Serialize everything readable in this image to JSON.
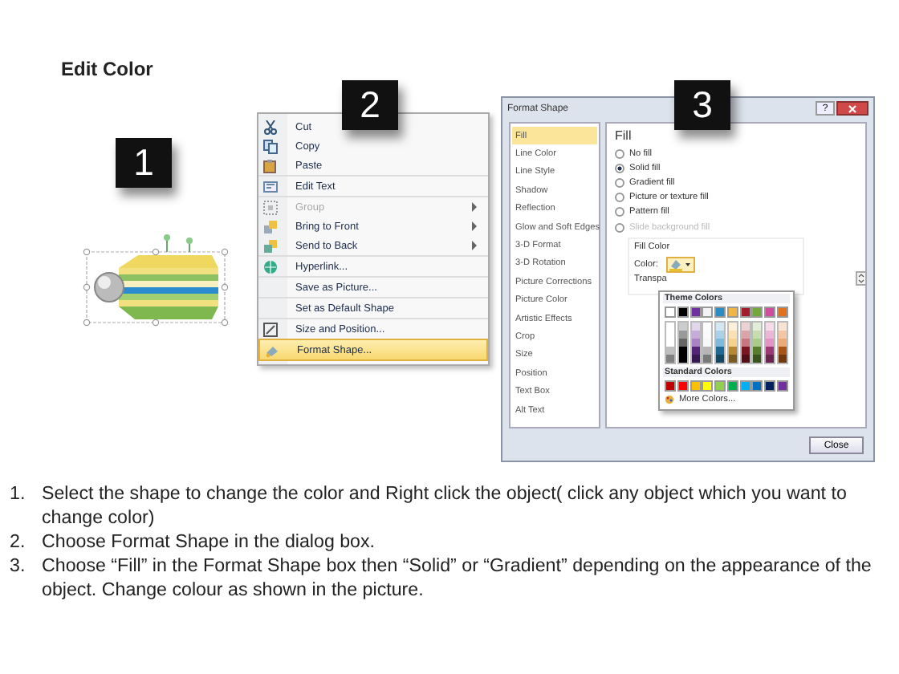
{
  "title": "Edit Color",
  "step_one": {
    "badge": "1"
  },
  "context_menu": {
    "badge": "2",
    "items": [
      {
        "label": "Cut",
        "submenu": false,
        "disabled": false,
        "selected": false,
        "separator_after": false
      },
      {
        "label": "Copy",
        "submenu": false,
        "disabled": false,
        "selected": false,
        "separator_after": false
      },
      {
        "label": "Paste",
        "submenu": false,
        "disabled": false,
        "selected": false,
        "separator_after": true
      },
      {
        "label": "Edit Text",
        "submenu": false,
        "disabled": false,
        "selected": false,
        "separator_after": true
      },
      {
        "label": "Group",
        "submenu": true,
        "disabled": true,
        "selected": false,
        "separator_after": false
      },
      {
        "label": "Bring to Front",
        "submenu": true,
        "disabled": false,
        "selected": false,
        "separator_after": false
      },
      {
        "label": "Send to Back",
        "submenu": true,
        "disabled": false,
        "selected": false,
        "separator_after": true
      },
      {
        "label": "Hyperlink...",
        "submenu": false,
        "disabled": false,
        "selected": false,
        "separator_after": true
      },
      {
        "label": "Save as Picture...",
        "submenu": false,
        "disabled": false,
        "selected": false,
        "separator_after": true
      },
      {
        "label": "Set as Default Shape",
        "submenu": false,
        "disabled": false,
        "selected": false,
        "separator_after": true
      },
      {
        "label": "Size and Position...",
        "submenu": false,
        "disabled": false,
        "selected": false,
        "separator_after": false
      },
      {
        "label": "Format Shape...",
        "submenu": false,
        "disabled": false,
        "selected": true,
        "separator_after": false
      }
    ]
  },
  "dialog": {
    "badge": "3",
    "title": "Format Shape",
    "help": "?",
    "categories": [
      {
        "label": "Fill",
        "selected": true
      },
      {
        "label": "Line Color",
        "selected": false
      },
      {
        "label": "Line Style",
        "selected": false
      },
      {
        "label": "Shadow",
        "selected": false
      },
      {
        "label": "Reflection",
        "selected": false
      },
      {
        "label": "Glow and Soft Edges",
        "selected": false
      },
      {
        "label": "3-D Format",
        "selected": false
      },
      {
        "label": "3-D Rotation",
        "selected": false
      },
      {
        "label": "Picture Corrections",
        "selected": false
      },
      {
        "label": "Picture Color",
        "selected": false
      },
      {
        "label": "Artistic Effects",
        "selected": false
      },
      {
        "label": "Crop",
        "selected": false
      },
      {
        "label": "Size",
        "selected": false
      },
      {
        "label": "Position",
        "selected": false
      },
      {
        "label": "Text Box",
        "selected": false
      },
      {
        "label": "Alt Text",
        "selected": false
      }
    ],
    "heading": "Fill",
    "options": [
      {
        "label": "No fill",
        "selected": false,
        "disabled": false
      },
      {
        "label": "Solid fill",
        "selected": true,
        "disabled": false
      },
      {
        "label": "Gradient fill",
        "selected": false,
        "disabled": false
      },
      {
        "label": "Picture or texture fill",
        "selected": false,
        "disabled": false
      },
      {
        "label": "Pattern fill",
        "selected": false,
        "disabled": false
      },
      {
        "label": "Slide background fill",
        "selected": false,
        "disabled": true
      }
    ],
    "group_label": "Fill Color",
    "color_label": "Color:",
    "transparency_label": "Transpa",
    "palette": {
      "theme_title": "Theme Colors",
      "theme": [
        {
          "color": "#ffffff"
        },
        {
          "color": "#000000"
        },
        {
          "color": "#7030a0"
        },
        {
          "color": "#f2f2f2"
        },
        {
          "color": "#2a8cc4"
        },
        {
          "color": "#f2b445"
        },
        {
          "color": "#a31c2c"
        },
        {
          "color": "#72a83a"
        },
        {
          "color": "#d04c9c"
        },
        {
          "color": "#e0721e"
        }
      ],
      "standard_title": "Standard Colors",
      "standard": [
        {
          "color": "#c00000"
        },
        {
          "color": "#ff0000"
        },
        {
          "color": "#ffc000"
        },
        {
          "color": "#ffff00"
        },
        {
          "color": "#92d050"
        },
        {
          "color": "#00b050"
        },
        {
          "color": "#00b0f0"
        },
        {
          "color": "#0070c0"
        },
        {
          "color": "#002060"
        },
        {
          "color": "#7030a0"
        }
      ],
      "more": "More Colors..."
    },
    "close_button": "Close"
  },
  "steps": [
    {
      "number": "1.",
      "text": "Select the shape to change the color and Right click the object( click any object which you want to change color)"
    },
    {
      "number": "2.",
      "text": "Choose Format Shape in the dialog box."
    },
    {
      "number": "3.",
      "text": "Choose “Fill” in the Format Shape box then “Solid” or “Gradient” depending on the appearance of the object. Change colour as shown in the picture."
    }
  ]
}
